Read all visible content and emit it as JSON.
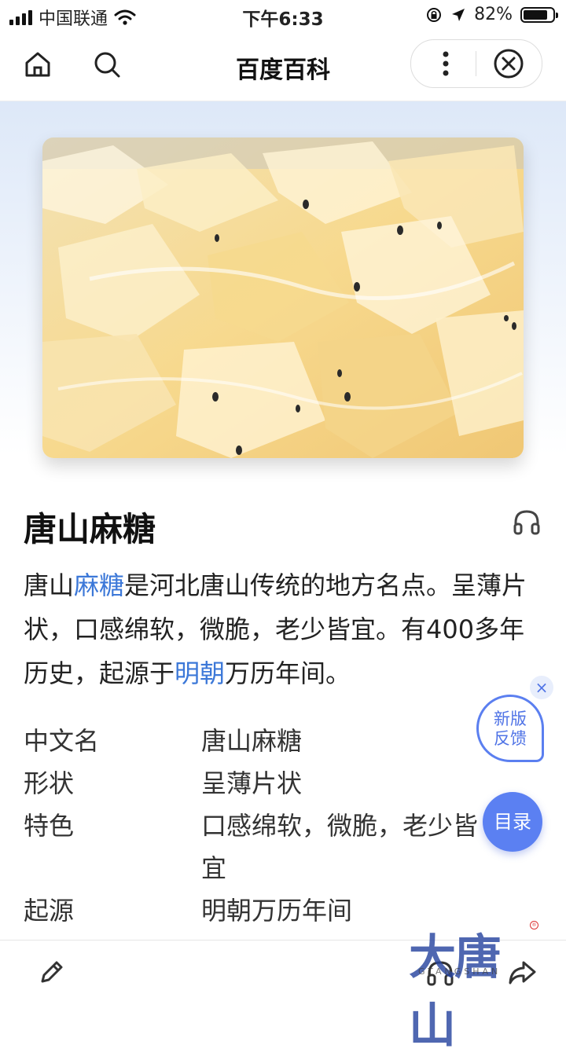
{
  "status_bar": {
    "carrier": "中国联通",
    "time": "下午6:33",
    "battery": "82%",
    "battery_level": 0.82
  },
  "nav": {
    "title": "百度百科"
  },
  "article": {
    "title": "唐山麻糖",
    "summary": [
      {
        "text": "唐山"
      },
      {
        "text": "麻糖",
        "link": true
      },
      {
        "text": "是河北唐山传统的地方名点。呈薄片状，口感绵软，微脆，老少皆宜。有400多年历史，起源于"
      },
      {
        "text": "明朝",
        "link": true
      },
      {
        "text": "万历年间。"
      }
    ],
    "info": [
      {
        "key": "中文名",
        "value": "唐山麻糖"
      },
      {
        "key": "形状",
        "value": "呈薄片状"
      },
      {
        "key": "特色",
        "value": "口感绵软，微脆，老少皆宜"
      },
      {
        "key": "起源",
        "value": "明朝万历年间"
      }
    ]
  },
  "float": {
    "feedback_line1": "新版",
    "feedback_line2": "反馈",
    "feedback_close": "×",
    "toc": "目录"
  },
  "watermark": {
    "text": "大唐山",
    "sub": "GTANGSHAN"
  },
  "icons": {
    "home": "home-icon",
    "search": "search-icon",
    "more": "more-icon",
    "close": "close-icon",
    "listen": "headphones-icon",
    "edit": "pencil-icon",
    "share": "share-icon"
  },
  "colors": {
    "link": "#3c78d8",
    "accent": "#5b80f2"
  }
}
